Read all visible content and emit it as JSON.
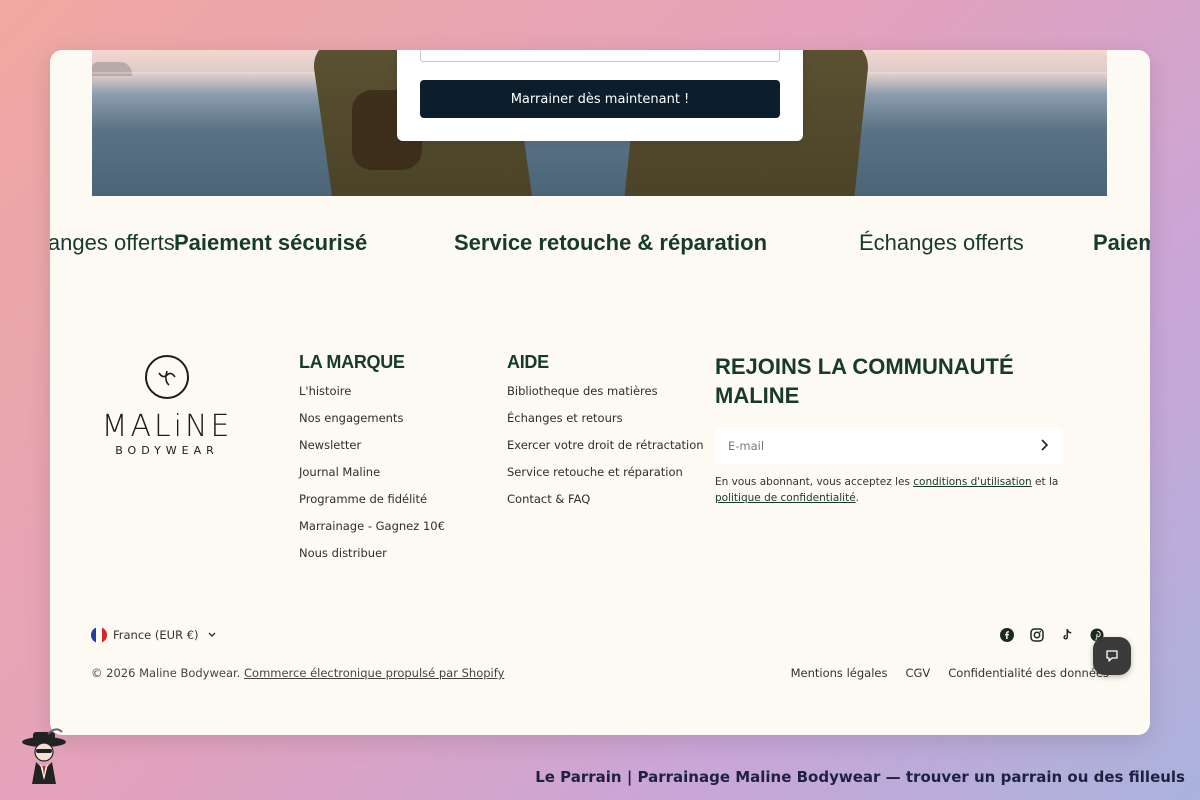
{
  "hero": {
    "cta_label": "Marrainer dès maintenant !"
  },
  "marquee": {
    "items": [
      {
        "text": "Échanges offerts",
        "bold": false
      },
      {
        "text": "Paiement sécurisé",
        "bold": true
      },
      {
        "text": "Service retouche & réparation",
        "bold": true
      },
      {
        "text": "Échanges offerts",
        "bold": false
      },
      {
        "text": "Paiement sécurisé",
        "bold": true
      }
    ]
  },
  "logo": {
    "word": "MALiNE",
    "sub": "BODYWEAR"
  },
  "columns": {
    "brand": {
      "title": "LA MARQUE",
      "links": [
        "L'histoire",
        "Nos engagements",
        "Newsletter",
        "Journal Maline",
        "Programme de fidélité",
        "Marrainage - Gagnez 10€",
        "Nous distribuer"
      ]
    },
    "help": {
      "title": "AIDE",
      "links": [
        "Bibliotheque des matières",
        "Échanges et retours",
        "Exercer votre droit de rétractation",
        "Service retouche et réparation",
        "Contact & FAQ"
      ]
    }
  },
  "community": {
    "title_line1": "REJOINS LA COMMUNAUTÉ",
    "title_line2": "MALINE",
    "email_placeholder": "E-mail",
    "consent_prefix": "En vous abonnant, vous acceptez les ",
    "consent_link1": "conditions d'utilisation",
    "consent_mid": " et la ",
    "consent_link2": "politique de confidentialité",
    "consent_suffix": "."
  },
  "bottom": {
    "locale": "France (EUR €)",
    "copyright_prefix": "© 2026 Maline Bodywear. ",
    "copyright_link": "Commerce électronique propulsé par Shopify",
    "legal_links": [
      "Mentions légales",
      "CGV",
      "Confidentialité des données"
    ],
    "socials": [
      "facebook-icon",
      "instagram-icon",
      "tiktok-icon",
      "pinterest-icon"
    ]
  },
  "banner": {
    "text": "Le Parrain | Parrainage Maline Bodywear — trouver un parrain ou des filleuls"
  },
  "colors": {
    "brand_green": "#173a2b",
    "cta_navy": "#0c1d2c",
    "card_bg": "#fdfaf3"
  }
}
